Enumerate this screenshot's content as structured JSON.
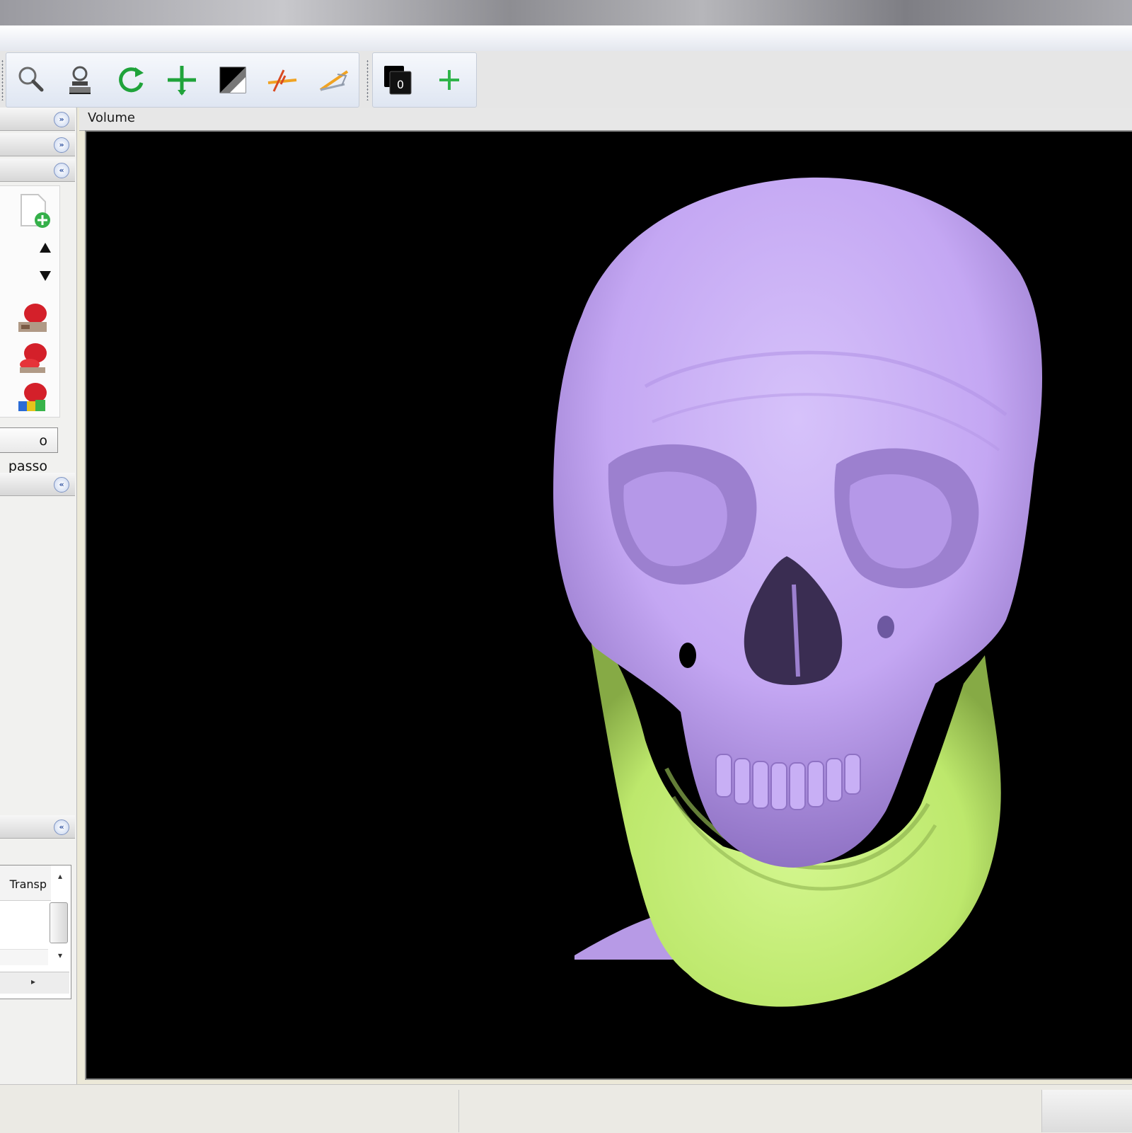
{
  "viewport": {
    "label": "Volume",
    "model": "3d-skull-render",
    "colors": {
      "skull": "#c4a7f3",
      "mandible": "#c0ee72",
      "background": "#000000"
    }
  },
  "toolbar": {
    "tools": [
      "zoom-icon",
      "zoom-window-icon",
      "rotate-icon",
      "pan-icon",
      "window-level-icon",
      "measure-icon",
      "angle-icon"
    ],
    "extra": [
      "layers-icon",
      "add-icon"
    ],
    "layers_badge": "0"
  },
  "left_panel": {
    "next_button": "o passo",
    "list_column_header": "Transp"
  }
}
